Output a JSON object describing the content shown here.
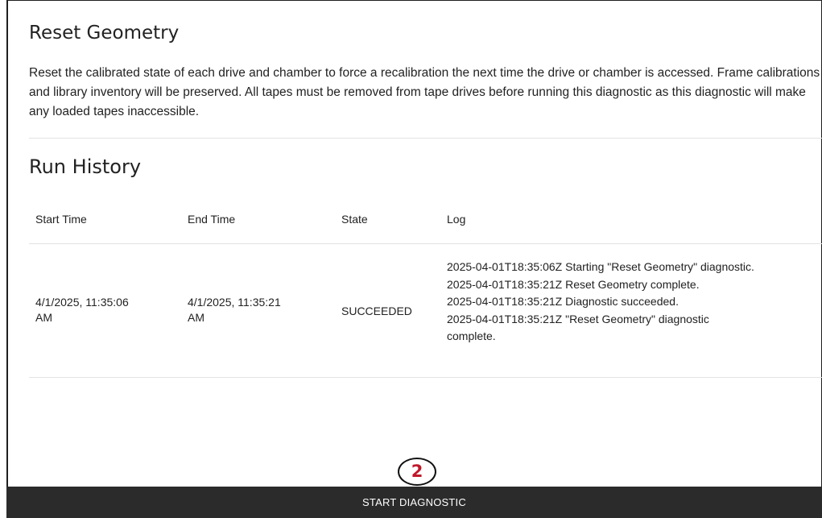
{
  "page": {
    "title": "Reset Geometry",
    "description": "Reset the calibrated state of each drive and chamber to force a recalibration the next time the drive or chamber is accessed. Frame calibrations and library inventory will be preserved. All tapes must be removed from tape drives before running this diagnostic as this diagnostic will make any loaded tapes inaccessible."
  },
  "run_history": {
    "title": "Run History",
    "columns": [
      "Start Time",
      "End Time",
      "State",
      "Log"
    ],
    "rows": [
      {
        "start_time": [
          "4/1/2025, 11:35:06",
          "AM"
        ],
        "end_time": [
          "4/1/2025, 11:35:21",
          "AM"
        ],
        "state": "SUCCEEDED",
        "log": [
          "2025-04-01T18:35:06Z Starting \"Reset Geometry\" diagnostic.",
          "2025-04-01T18:35:21Z Reset Geometry complete.",
          "2025-04-01T18:35:21Z Diagnostic succeeded.",
          "2025-04-01T18:35:21Z \"Reset Geometry\" diagnostic",
          "complete."
        ]
      }
    ]
  },
  "callout": {
    "number": "2",
    "color": "#c0182a"
  },
  "footer": {
    "start_label": "START DIAGNOSTIC",
    "bg_color": "#2b2b2b"
  }
}
